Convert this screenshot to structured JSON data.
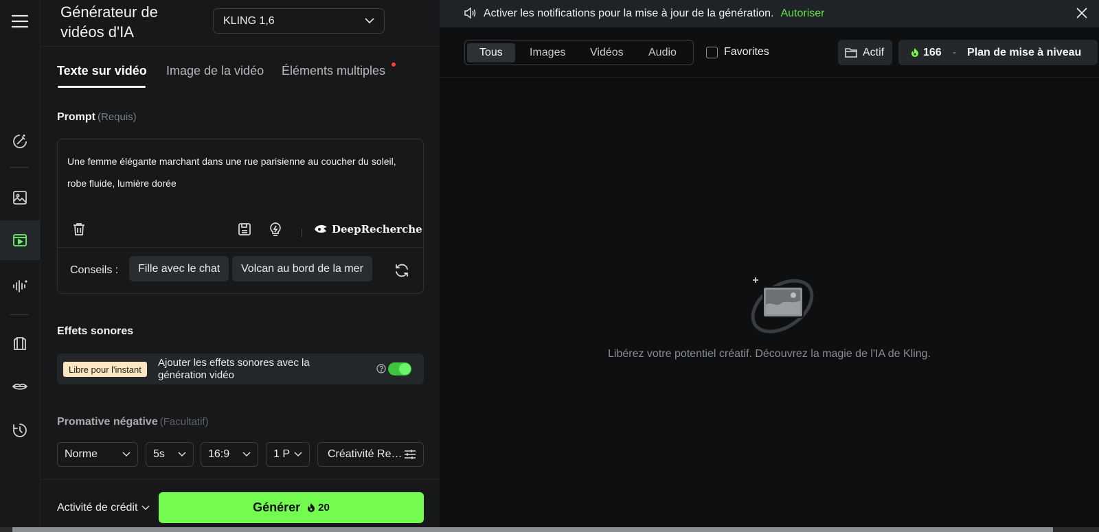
{
  "app": {
    "title": "Générateur de vidéos d'IA",
    "model": "KLING 1,6"
  },
  "rail": {
    "items": [
      "menu-icon",
      "magic-edit-icon",
      "image-icon",
      "video-icon",
      "audio-wave-icon",
      "shirt-icon",
      "lips-icon",
      "history-icon"
    ],
    "active": "video-icon"
  },
  "tabs": [
    {
      "label": "Texte sur vidéo",
      "active": true
    },
    {
      "label": "Image de la vidéo",
      "active": false
    },
    {
      "label": "Éléments multiples",
      "active": false
    }
  ],
  "prompt": {
    "label": "Prompt",
    "required": "(Requis)",
    "text": "Une femme élégante marchant dans une rue parisienne au coucher du soleil, robe fluide, lumière dorée",
    "deep_label": "DeepRecherche"
  },
  "tips": {
    "label": "Conseils :",
    "chips": [
      "Fille avec le chat",
      "Volcan au bord de la mer"
    ]
  },
  "sound": {
    "section_label": "Effets sonores",
    "badge": "Libre pour l'instant",
    "text": "Ajouter les effets sonores avec la génération vidéo",
    "enabled": true
  },
  "negative": {
    "label": "Promative négative",
    "optional": "(Facultatif)"
  },
  "settings": {
    "mode": "Norme",
    "duration": "5s",
    "ratio": "16:9",
    "count": "1 P",
    "creativity": "Créativité Re…"
  },
  "footer": {
    "credit_label": "Activité de crédit",
    "generate_label": "Générer",
    "generate_cost": "20"
  },
  "notification": {
    "text": "Activer les notifications pour la mise à jour de la génération.",
    "action": "Autoriser"
  },
  "filters": {
    "tabs": [
      "Tous",
      "Images",
      "Vidéos",
      "Audio"
    ],
    "active": "Tous",
    "favorites_label": "Favorites"
  },
  "account": {
    "active_label": "Actif",
    "credits": "166",
    "separator": "-",
    "upgrade_label": "Plan de mise à niveau"
  },
  "empty_state": {
    "text": "Libérez votre potentiel créatif. Découvrez la magie de l'IA de Kling."
  },
  "colors": {
    "accent_green": "#74fb4f",
    "link_green": "#65e045",
    "panel_bg": "#16181a",
    "canvas_bg": "#0e0f10"
  }
}
